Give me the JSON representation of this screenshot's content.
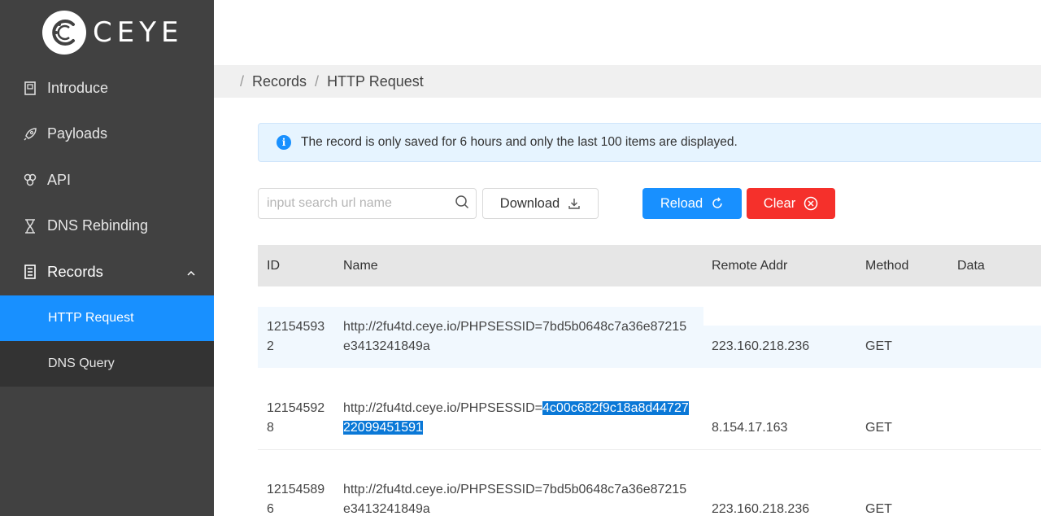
{
  "app": {
    "logo_text": "CEYE"
  },
  "sidebar": {
    "items": [
      {
        "label": "Introduce",
        "icon": "book-icon"
      },
      {
        "label": "Payloads",
        "icon": "rocket-icon"
      },
      {
        "label": "API",
        "icon": "api-icon"
      },
      {
        "label": "DNS Rebinding",
        "icon": "hourglass-icon"
      },
      {
        "label": "Records",
        "icon": "records-icon"
      }
    ],
    "sub_items": [
      {
        "label": "HTTP Request",
        "active": true
      },
      {
        "label": "DNS Query",
        "active": false
      }
    ]
  },
  "breadcrumb": {
    "items": [
      "Records",
      "HTTP Request"
    ]
  },
  "alert": {
    "text": "The record is only saved for 6 hours and only the last 100 items are displayed."
  },
  "toolbar": {
    "search_placeholder": "input search url name",
    "download_label": "Download",
    "reload_label": "Reload",
    "clear_label": "Clear"
  },
  "table": {
    "columns": [
      "ID",
      "Name",
      "Remote Addr",
      "Method",
      "Data"
    ],
    "rows": [
      {
        "id_line1": "12154593",
        "id_line2": "2",
        "name_line1": "http://2fu4td.ceye.io/PHPSESSID=7bd5b0648c7a36e87215",
        "name_line2": "e3413241849a",
        "remote_addr": "223.160.218.236",
        "method": "GET",
        "data": ""
      },
      {
        "id_line1": "12154592",
        "id_line2": "8",
        "name_line1_plain": "http://2fu4td.ceye.io/PHPSESSID=",
        "name_line1_selected": "4c00c682f9c18a8d44727",
        "name_line2_selected": "22099451591",
        "remote_addr": "8.154.17.163",
        "method": "GET",
        "data": ""
      },
      {
        "id_line1": "12154589",
        "id_line2": "6",
        "name_line1": "http://2fu4td.ceye.io/PHPSESSID=7bd5b0648c7a36e87215",
        "name_line2": "e3413241849a",
        "remote_addr": "223.160.218.236",
        "method": "GET",
        "data": ""
      }
    ]
  },
  "colors": {
    "sidebar_bg": "#414141",
    "accent": "#1890ff",
    "danger": "#f5302b"
  }
}
